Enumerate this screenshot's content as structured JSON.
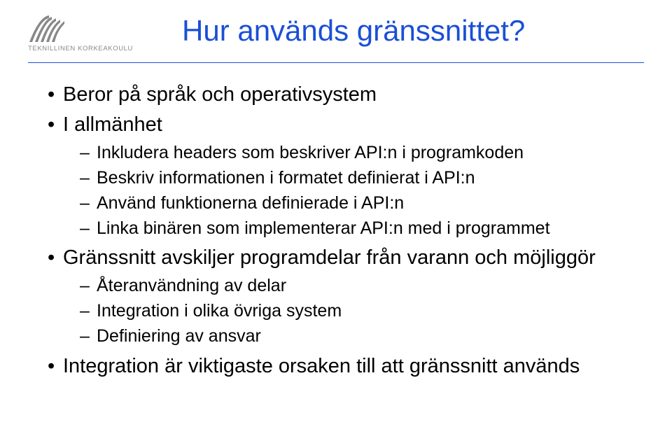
{
  "logo_text": "TEKNILLINEN KORKEAKOULU",
  "title": "Hur används gränssnittet?",
  "bullets": [
    {
      "text": "Beror på språk och operativsystem"
    },
    {
      "text": "I allmänhet",
      "children": [
        "Inkludera headers som beskriver API:n i programkoden",
        "Beskriv informationen i formatet definierat i API:n",
        "Använd funktionerna definierade i API:n",
        "Linka binären som implementerar API:n med i programmet"
      ]
    },
    {
      "text": "Gränssnitt avskiljer programdelar från varann och möjliggör",
      "children": [
        "Återanvändning av delar",
        "Integration i olika övriga system",
        "Definiering av ansvar"
      ]
    },
    {
      "text": "Integration är viktigaste orsaken till att gränssnitt används"
    }
  ]
}
